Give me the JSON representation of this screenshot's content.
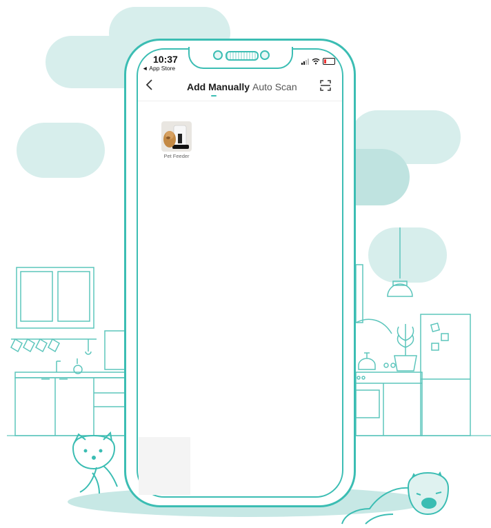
{
  "status_bar": {
    "time": "10:37",
    "back_app": "◄ App Store"
  },
  "nav": {
    "back_icon": "chevron-left-icon",
    "tabs": [
      {
        "label": "Add Manually",
        "active": true
      },
      {
        "label": "Auto Scan",
        "active": false
      }
    ],
    "scan_icon": "scan-icon"
  },
  "devices": [
    {
      "label": "Pet Feeder",
      "icon": "pet-feeder-thumbnail"
    }
  ],
  "colors": {
    "accent": "#3bbdb3",
    "bg_blob": "#d3ecea",
    "bg_blob_dark": "#bfe3e0"
  }
}
